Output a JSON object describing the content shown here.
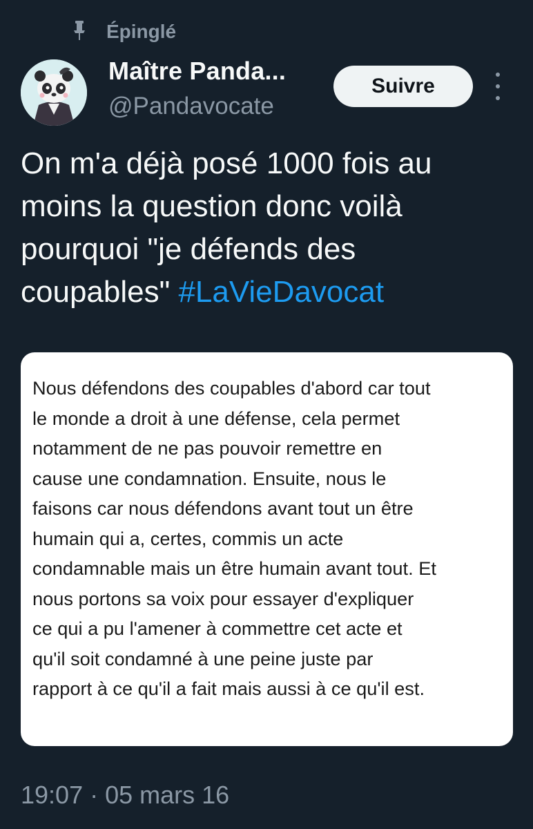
{
  "pinned_label": "Épinglé",
  "author": {
    "display_name": "Maître Panda...",
    "handle": "@Pandavocate"
  },
  "follow_label": "Suivre",
  "tweet": {
    "text_plain": "On m'a déjà posé 1000 fois au moins la question donc voilà pourquoi \"je défends des coupables\"",
    "hashtag": "#LaVieDavocat",
    "image_lines": [
      "Nous défendons des coupables d'abord car tout",
      "le monde a droit à une défense, cela permet",
      "notamment de ne pas pouvoir remettre en",
      "cause une condamnation. Ensuite, nous le",
      "faisons car nous défendons avant tout un être",
      "humain qui a, certes, commis un acte",
      "condamnable mais un être humain avant tout. Et",
      "nous portons sa voix pour essayer d'expliquer",
      "ce qui a pu l'amener à commettre cet acte et",
      "qu'il soit condamné à une peine juste par",
      "rapport à ce qu'il a fait mais aussi à ce qu'il est."
    ]
  },
  "timestamp": "19:07 · 05 mars 16",
  "icons": {
    "pin": "pin-icon",
    "more": "more-options-icon",
    "avatar": "panda-avatar"
  },
  "colors": {
    "background": "#15202b",
    "accent": "#1d9bf0",
    "secondary_text": "#8b98a5"
  }
}
